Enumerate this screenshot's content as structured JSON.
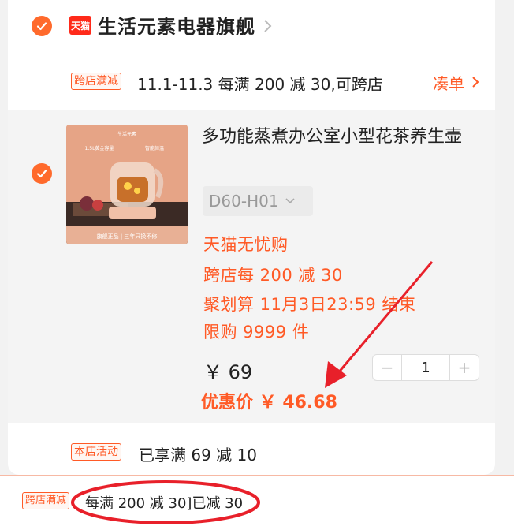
{
  "store": {
    "logo_text": "天猫",
    "name": "生活元素电器旗舰"
  },
  "promo": {
    "tag": "跨店满减",
    "text": "11.1-11.3 每满 200 减 30,可跨店",
    "action": "凑单"
  },
  "product": {
    "thumb_brand": "生活元素",
    "thumb_feature_1": "1.5L黄金容量",
    "thumb_feature_2": "智能恒温",
    "thumb_footer": "旗舰正品 | 三年只换不修",
    "title": "多功能蒸煮办公室小型花茶养生壶",
    "sku": "D60-H01",
    "benefits": [
      "天猫无忧购",
      "跨店每 200 减 30",
      "聚划算 11月3日23:59 结束",
      "限购 9999 件"
    ],
    "price": "￥ 69",
    "deal_price": "优惠价 ￥ 46.68",
    "quantity": "1",
    "minus": "−",
    "plus": "+"
  },
  "store_activity": {
    "tag": "本店活动",
    "text": "已享满 69 减 10"
  },
  "bottom": {
    "tag": "跨店满减",
    "text": "每满 200 减 30]已减 30"
  },
  "colors": {
    "accent": "#ff5a26",
    "annotation": "#e8202a"
  }
}
